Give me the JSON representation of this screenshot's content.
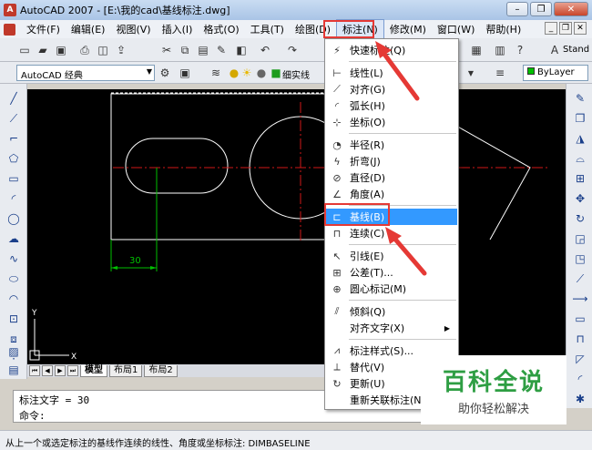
{
  "window": {
    "title": "AutoCAD 2007 - [E:\\我的cad\\基线标注.dwg]",
    "app_icon": "A"
  },
  "menubar": [
    {
      "label": "文件(F)"
    },
    {
      "label": "编辑(E)"
    },
    {
      "label": "视图(V)"
    },
    {
      "label": "插入(I)"
    },
    {
      "label": "格式(O)"
    },
    {
      "label": "工具(T)"
    },
    {
      "label": "绘图(D)"
    },
    {
      "label": "标注(N)"
    },
    {
      "label": "修改(M)"
    },
    {
      "label": "窗口(W)"
    },
    {
      "label": "帮助(H)"
    }
  ],
  "toolbar": {
    "style_partial": "Stand",
    "workspace": "AutoCAD 经典",
    "linetype_partial": "细实线",
    "lineweight": "ByLayer"
  },
  "dimension_menu": [
    {
      "label": "快速标注(Q)",
      "icon": "quick-dimension-icon",
      "glyph": "⚡"
    },
    {
      "label": "线性(L)",
      "icon": "linear-dimension-icon",
      "glyph": "⊢"
    },
    {
      "label": "对齐(G)",
      "icon": "aligned-dimension-icon",
      "glyph": "⟋"
    },
    {
      "label": "弧长(H)",
      "icon": "arc-length-icon",
      "glyph": "◜"
    },
    {
      "label": "坐标(O)",
      "icon": "ordinate-icon",
      "glyph": "⊹"
    },
    {
      "label": "半径(R)",
      "icon": "radius-icon",
      "glyph": "◔"
    },
    {
      "label": "折弯(J)",
      "icon": "jogged-icon",
      "glyph": "ϟ"
    },
    {
      "label": "直径(D)",
      "icon": "diameter-icon",
      "glyph": "⊘"
    },
    {
      "label": "角度(A)",
      "icon": "angular-icon",
      "glyph": "∠"
    },
    {
      "label": "基线(B)",
      "icon": "baseline-icon",
      "glyph": "⊏"
    },
    {
      "label": "连续(C)",
      "icon": "continue-icon",
      "glyph": "⊓"
    },
    {
      "label": "引线(E)",
      "icon": "leader-icon",
      "glyph": "↖"
    },
    {
      "label": "公差(T)...",
      "icon": "tolerance-icon",
      "glyph": "⊞"
    },
    {
      "label": "圆心标记(M)",
      "icon": "center-mark-icon",
      "glyph": "⊕"
    },
    {
      "label": "倾斜(Q)",
      "icon": "oblique-icon",
      "glyph": "⫽"
    },
    {
      "label": "对齐文字(X)",
      "icon": "",
      "glyph": ""
    },
    {
      "label": "标注样式(S)...",
      "icon": "dim-style-icon",
      "glyph": "⩘"
    },
    {
      "label": "替代(V)",
      "icon": "override-icon",
      "glyph": "⟂"
    },
    {
      "label": "更新(U)",
      "icon": "update-icon",
      "glyph": "↻"
    },
    {
      "label": "重新关联标注(N)",
      "icon": "",
      "glyph": ""
    }
  ],
  "drawing": {
    "dimension_text": "30",
    "ucs_y": "Y",
    "ucs_x": "X"
  },
  "layout_tabs": [
    {
      "label": "模型"
    },
    {
      "label": "布局1"
    },
    {
      "label": "布局2"
    }
  ],
  "command": {
    "line1": "标注文字 = 30",
    "line2": "命令:"
  },
  "status_text": "从上一个或选定标注的基线作连续的线性、角度或坐标标注:  DIMBASELINE",
  "watermark": {
    "title": "百科全说",
    "subtitle": "助你轻松解决"
  },
  "colors": {
    "highlight": "#3399ff",
    "annotation_red": "#e53935",
    "dim_green": "#00c000",
    "centerline_red": "#d01818",
    "brand_green": "#2e9e43"
  }
}
